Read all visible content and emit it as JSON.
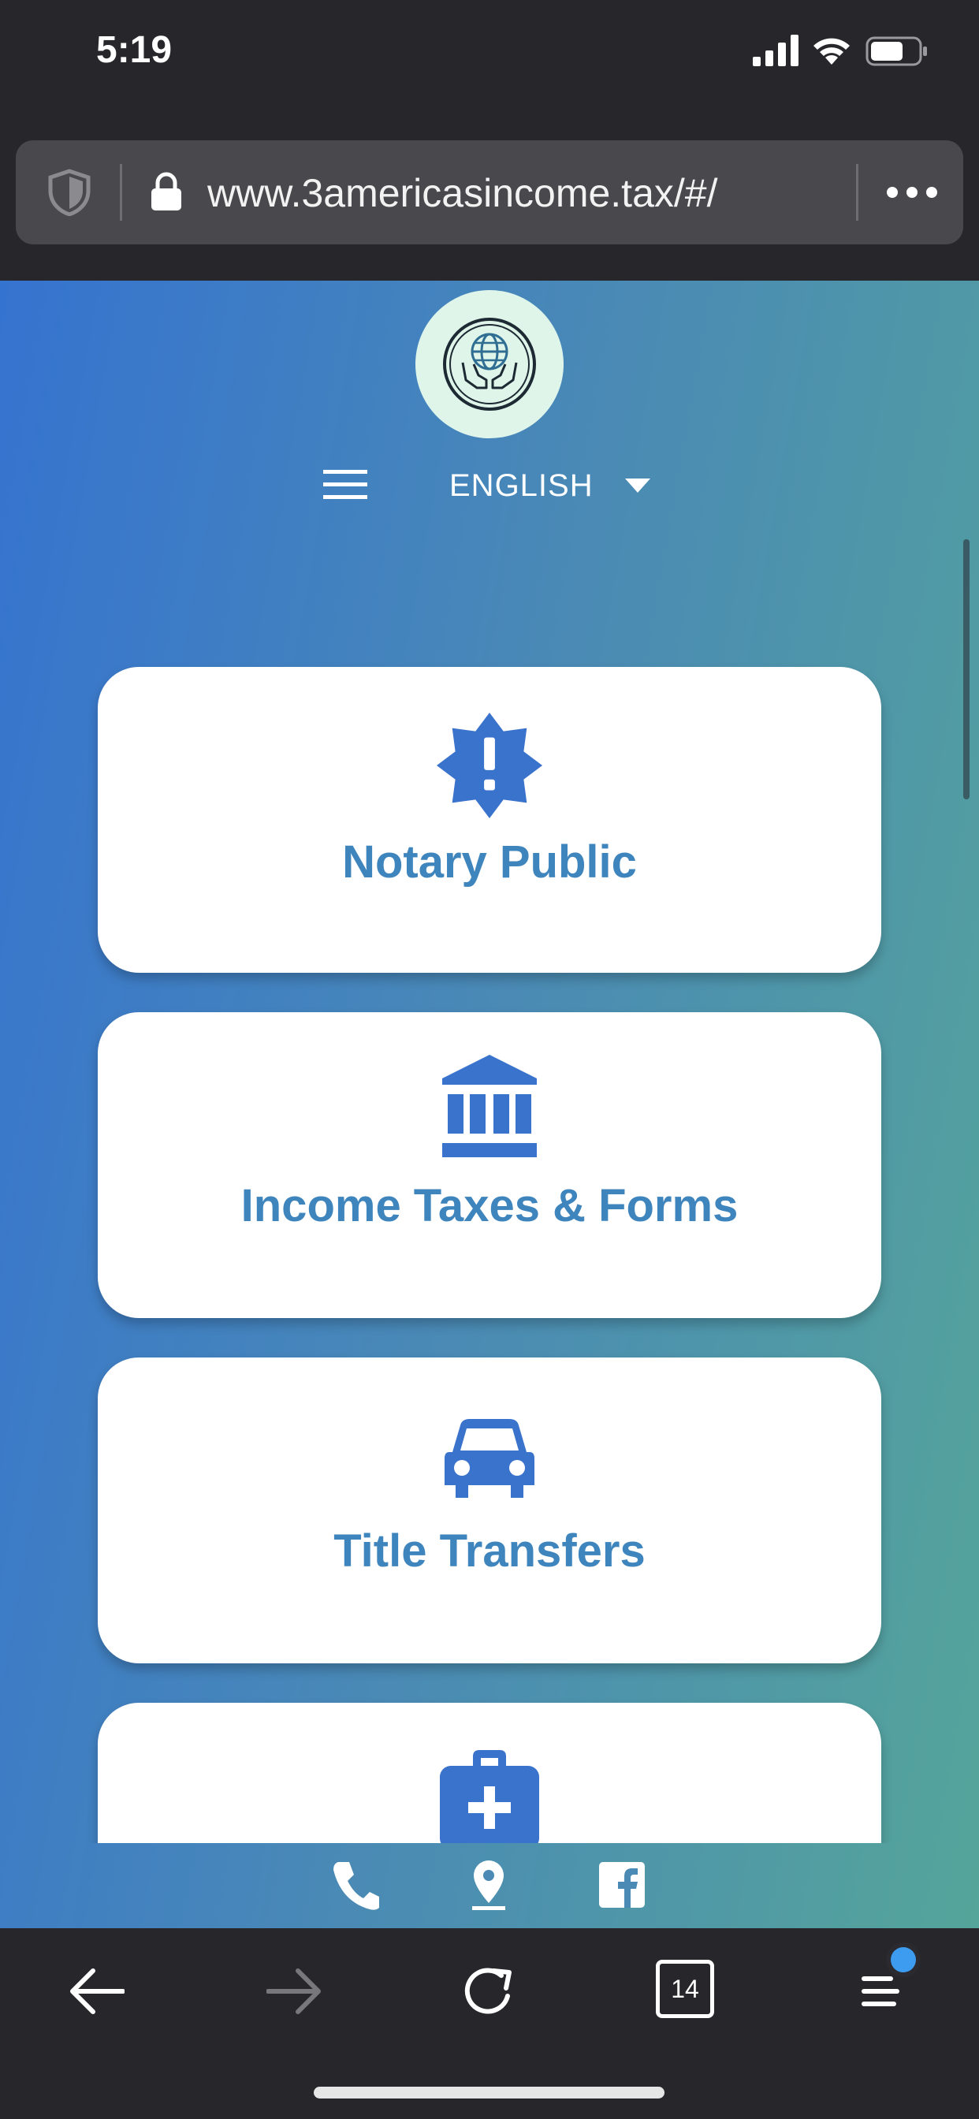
{
  "status_bar": {
    "time": "5:19",
    "icons": [
      "signal-icon",
      "wifi-icon",
      "battery-icon"
    ]
  },
  "browser": {
    "url": "www.3americasincome.tax/#/",
    "tab_count": "14",
    "icons": [
      "shield-icon",
      "lock-icon",
      "more-icon",
      "back-icon",
      "forward-icon",
      "reload-icon",
      "tabs-icon",
      "menu-icon"
    ]
  },
  "header": {
    "language": "ENGLISH",
    "icons": [
      "logo-globe-icon",
      "hamburger-icon",
      "caret-down-icon"
    ]
  },
  "services": [
    {
      "label": "Notary Public",
      "icon": "badge-exclamation-icon"
    },
    {
      "label": "Income Taxes & Forms",
      "icon": "bank-icon"
    },
    {
      "label": "Title Transfers",
      "icon": "car-icon"
    },
    {
      "label": "",
      "icon": "medical-kit-icon"
    }
  ],
  "footer": {
    "icons": [
      "phone-icon",
      "location-pin-icon",
      "facebook-icon"
    ]
  },
  "colors": {
    "gradient_start": "#3573d0",
    "gradient_end": "#55a59a",
    "card_text": "#3f85bd",
    "icon_blue": "#3a73cc",
    "logo_bg": "#dff5ea",
    "browser_chrome": "#26262b"
  }
}
